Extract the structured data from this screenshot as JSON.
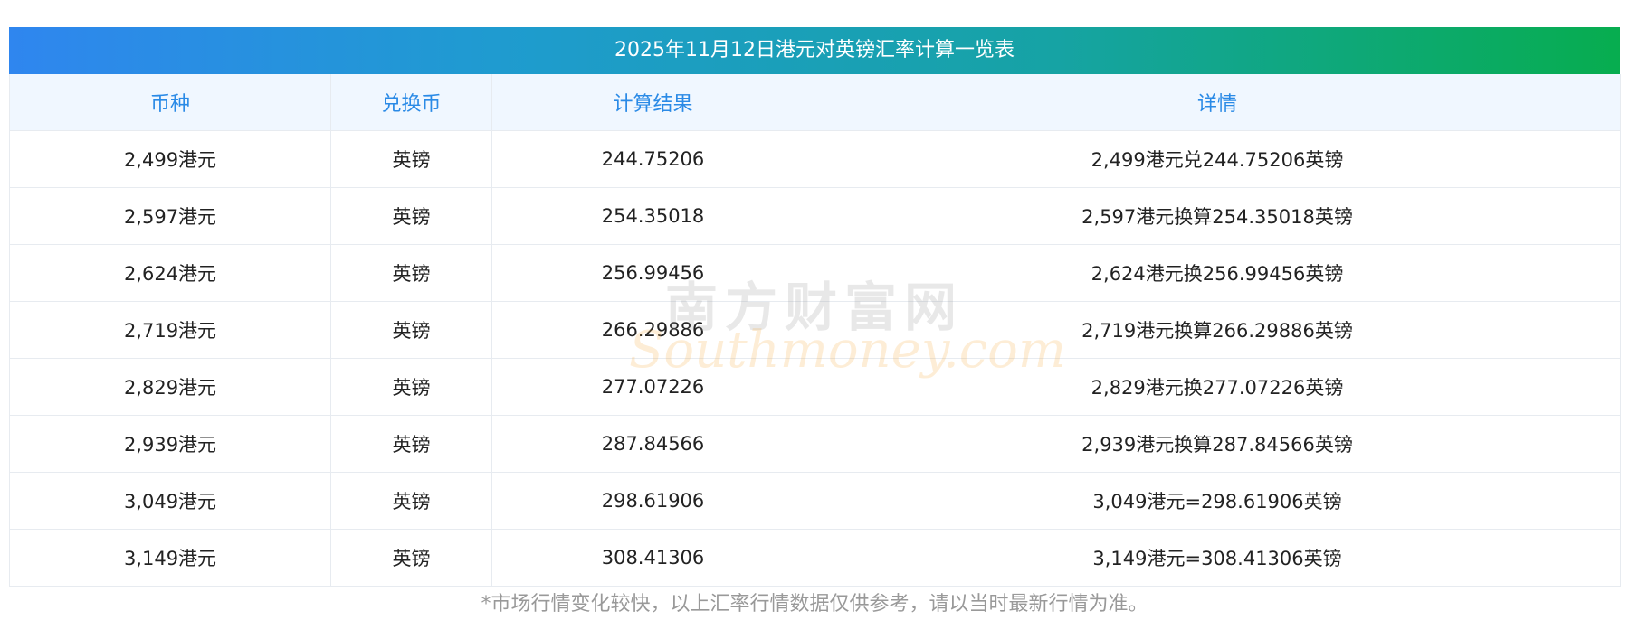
{
  "table": {
    "title": "2025年11月12日港元对英镑汇率计算一览表",
    "headers": [
      "币种",
      "兑换币",
      "计算结果",
      "详情"
    ],
    "rows": [
      {
        "currency": "2,499港元",
        "target": "英镑",
        "result": "244.75206",
        "detail": "2,499港元兑244.75206英镑"
      },
      {
        "currency": "2,597港元",
        "target": "英镑",
        "result": "254.35018",
        "detail": "2,597港元换算254.35018英镑"
      },
      {
        "currency": "2,624港元",
        "target": "英镑",
        "result": "256.99456",
        "detail": "2,624港元换256.99456英镑"
      },
      {
        "currency": "2,719港元",
        "target": "英镑",
        "result": "266.29886",
        "detail": "2,719港元换算266.29886英镑"
      },
      {
        "currency": "2,829港元",
        "target": "英镑",
        "result": "277.07226",
        "detail": "2,829港元换277.07226英镑"
      },
      {
        "currency": "2,939港元",
        "target": "英镑",
        "result": "287.84566",
        "detail": "2,939港元换算287.84566英镑"
      },
      {
        "currency": "3,049港元",
        "target": "英镑",
        "result": "298.61906",
        "detail": "3,049港元=298.61906英镑"
      },
      {
        "currency": "3,149港元",
        "target": "英镑",
        "result": "308.41306",
        "detail": "3,149港元=308.41306英镑"
      }
    ]
  },
  "watermark": {
    "cn": "南方财富网",
    "en": "Southmoney.com"
  },
  "footnote": "*市场行情变化较快，以上汇率行情数据仅供参考，请以当时最新行情为准。"
}
